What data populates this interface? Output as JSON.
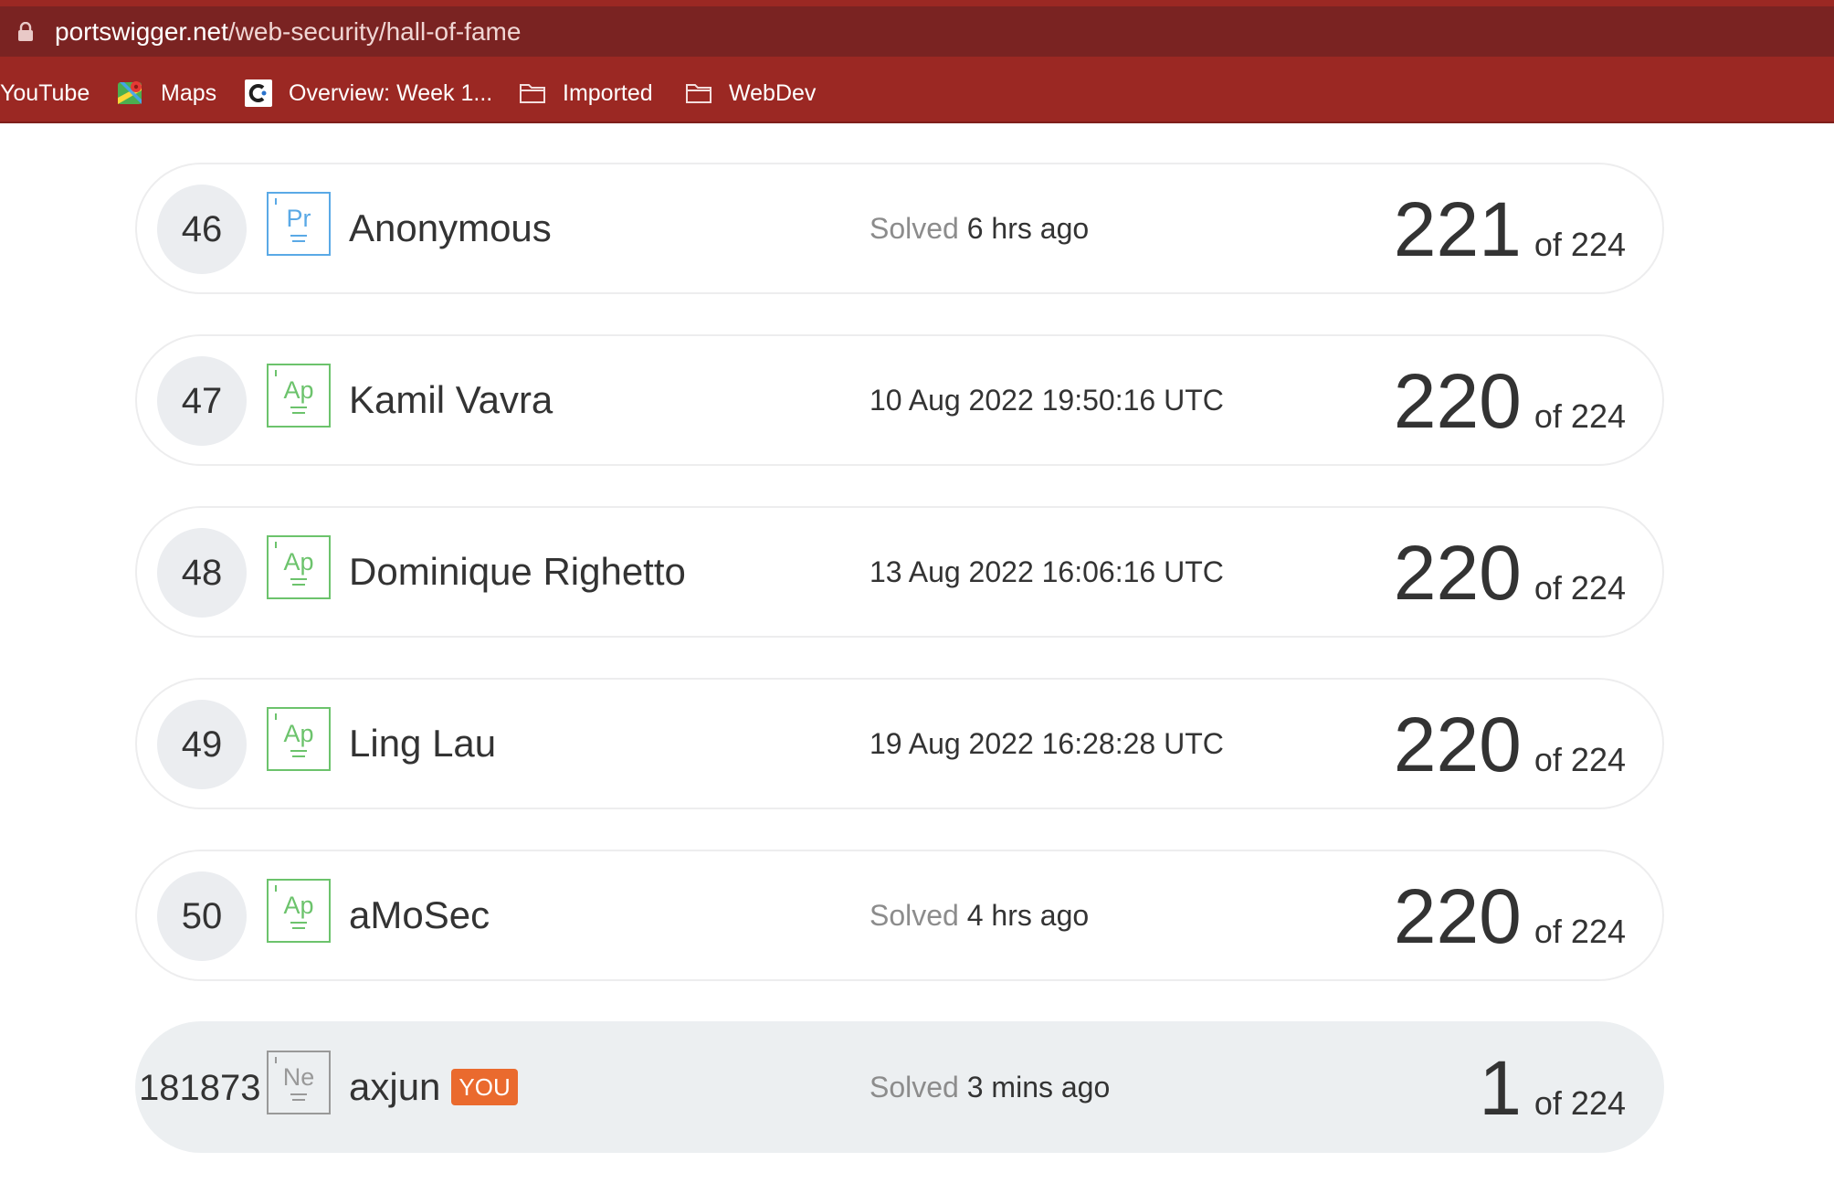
{
  "browser": {
    "url_host": "portswigger.net",
    "url_path": "/web-security/hall-of-fame",
    "bookmarks": [
      {
        "label": "YouTube",
        "icon": "youtube-icon"
      },
      {
        "label": "Maps",
        "icon": "maps-icon"
      },
      {
        "label": "Overview: Week 1...",
        "icon": "coursera-icon"
      },
      {
        "label": "Imported",
        "icon": "folder-icon"
      },
      {
        "label": "WebDev",
        "icon": "folder-icon"
      }
    ]
  },
  "leaderboard": {
    "rows": [
      {
        "rank": "46",
        "badge": "Pr",
        "badge_color": "#5aa9e6",
        "name": "Anonymous",
        "solved_prefix": "Solved",
        "solved_time": "6 hrs ago",
        "score": "221",
        "of_total": "of 224"
      },
      {
        "rank": "47",
        "badge": "Ap",
        "badge_color": "#6cc36c",
        "name": "Kamil Vavra",
        "solved_prefix": "",
        "solved_time": "10 Aug 2022 19:50:16 UTC",
        "score": "220",
        "of_total": "of 224"
      },
      {
        "rank": "48",
        "badge": "Ap",
        "badge_color": "#6cc36c",
        "name": "Dominique Righetto",
        "solved_prefix": "",
        "solved_time": "13 Aug 2022 16:06:16 UTC",
        "score": "220",
        "of_total": "of 224"
      },
      {
        "rank": "49",
        "badge": "Ap",
        "badge_color": "#6cc36c",
        "name": "Ling Lau",
        "solved_prefix": "",
        "solved_time": "19 Aug 2022 16:28:28 UTC",
        "score": "220",
        "of_total": "of 224"
      },
      {
        "rank": "50",
        "badge": "Ap",
        "badge_color": "#6cc36c",
        "name": "aMoSec",
        "solved_prefix": "Solved",
        "solved_time": "4 hrs ago",
        "score": "220",
        "of_total": "of 224"
      }
    ],
    "you_row": {
      "rank": "181873",
      "badge": "Ne",
      "badge_color": "#999999",
      "name": "axjun",
      "you_label": "YOU",
      "you_color": "#ea6a2e",
      "solved_prefix": "Solved",
      "solved_time": "3 mins ago",
      "score": "1",
      "of_total": "of 224"
    }
  }
}
